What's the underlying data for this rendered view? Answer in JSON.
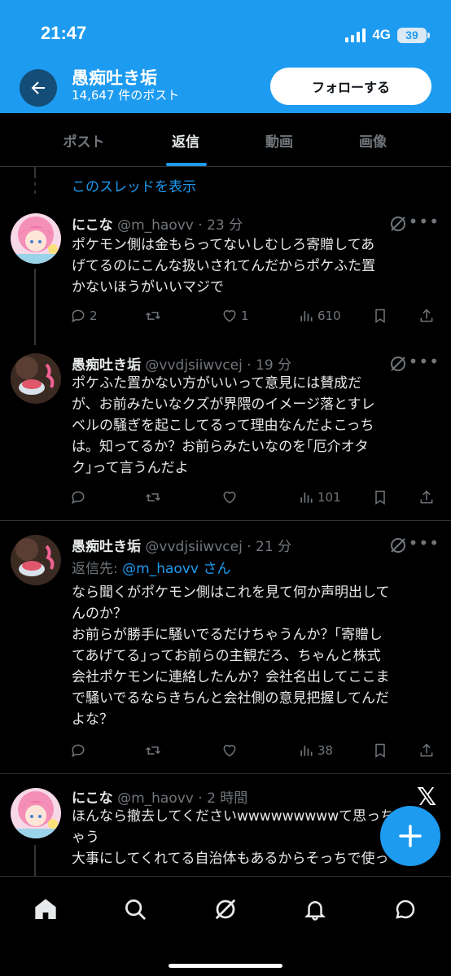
{
  "status_bar": {
    "time": "21:47",
    "network": "4G",
    "battery": "39"
  },
  "header": {
    "title": "愚痴吐き垢",
    "subtitle": "14,647 件のポスト",
    "follow_label": "フォローする"
  },
  "tabs": [
    {
      "label": "ポスト"
    },
    {
      "label": "返信"
    },
    {
      "label": "動画"
    },
    {
      "label": "画像"
    }
  ],
  "active_tab": "返信",
  "show_thread": "このスレッドを表示",
  "tweets": [
    {
      "name": "にこな",
      "handle": "@m_haovv",
      "time": "· 23 分",
      "text": "ポケモン側は金もらってないしむしろ寄贈してあ\nげてるのにこんな扱いされてんだからポケふた置\nかないほうがいいマジで",
      "replies": "2",
      "reposts": "",
      "likes": "1",
      "views": "610"
    },
    {
      "name": "愚痴吐き垢",
      "handle": "@vvdjsiiwvcej",
      "time": "· 19 分",
      "text": "ポケふた置かない方がいいって意見には賛成だ\nが、お前みたいなクズが界隈のイメージ落とすレ\nベルの騒ぎを起こしてるって理由なんだよこっち\nは。知ってるか？お前らみたいなのを｢厄介オタ\nク｣って言うんだよ",
      "replies": "",
      "reposts": "",
      "likes": "",
      "views": "101"
    },
    {
      "name": "愚痴吐き垢",
      "handle": "@vvdjsiiwvcej",
      "time": "· 21 分",
      "reply_prefix": "返信先: ",
      "reply_mention": "@m_haovv",
      "reply_suffix": " さん",
      "text": "なら聞くがポケモン側はこれを見て何か声明出して\nんのか？\nお前らが勝手に騒いでるだけちゃうんか？｢寄贈し\nてあげてる｣ってお前らの主観だろ、ちゃんと株式\n会社ポケモンに連絡したんか？会社名出してここま\nで騒いでるならきちんと会社側の意見把握してんだ\nよな？",
      "replies": "",
      "reposts": "",
      "likes": "",
      "views": "38"
    },
    {
      "name": "にこな",
      "handle": "@m_haovv",
      "time": "· 2 時間",
      "text": "ほんなら撤去してくださいwwwwwwwwwて思っち\nゃう\n大事にしてくれてる自治体もあるからそっちで使っ"
    }
  ],
  "colors": {
    "accent": "#1d9bf0",
    "background": "#000000",
    "muted": "#71767b",
    "text": "#e7e9ea"
  }
}
